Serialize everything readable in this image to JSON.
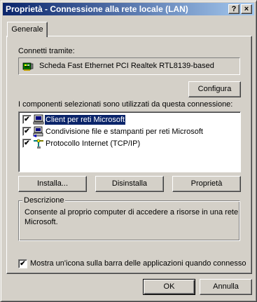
{
  "window": {
    "title": "Proprietà - Connessione alla rete locale (LAN)",
    "help_button": "?",
    "close_button": "×"
  },
  "tabs": [
    {
      "label": "Generale"
    }
  ],
  "connect_using": {
    "label": "Connetti tramite:",
    "adapter": "Scheda Fast Ethernet PCI Realtek RTL8139-based",
    "configure_button": "Configura"
  },
  "components": {
    "label": "I componenti selezionati sono utilizzati da questa connessione:",
    "items": [
      {
        "label": "Client per reti Microsoft",
        "checked": true,
        "selected": true,
        "icon": "client-network-icon"
      },
      {
        "label": "Condivisione file e stampanti per reti Microsoft",
        "checked": true,
        "selected": false,
        "icon": "file-printer-sharing-icon"
      },
      {
        "label": "Protocollo Internet (TCP/IP)",
        "checked": true,
        "selected": false,
        "icon": "protocol-icon"
      }
    ]
  },
  "actions": {
    "install": "Installa...",
    "uninstall": "Disinstalla",
    "properties": "Proprietà"
  },
  "description": {
    "legend": "Descrizione",
    "text": "Consente al proprio computer di accedere a risorse in una rete Microsoft."
  },
  "show_icon": {
    "label": "Mostra un'icona sulla barra delle applicazioni quando connesso",
    "checked": true
  },
  "footer": {
    "ok": "OK",
    "cancel": "Annulla"
  }
}
